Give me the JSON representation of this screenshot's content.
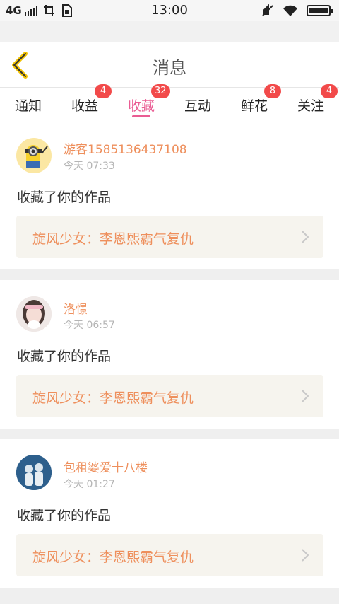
{
  "status_bar": {
    "network": "4G",
    "time": "13:00",
    "icons": [
      "signal-icon",
      "screenshot-icon",
      "sim-card-icon",
      "mute-icon",
      "wifi-icon",
      "battery-icon"
    ]
  },
  "header": {
    "title": "消息",
    "back_icon": "chevron-left-icon",
    "accent": "#f2c200"
  },
  "tabs": [
    {
      "label": "通知",
      "badge": ""
    },
    {
      "label": "收益",
      "badge": "4"
    },
    {
      "label": "收藏",
      "badge": "32",
      "active": true
    },
    {
      "label": "互动",
      "badge": ""
    },
    {
      "label": "鲜花",
      "badge": "8"
    },
    {
      "label": "关注",
      "badge": "4"
    }
  ],
  "colors": {
    "active_tab": "#ea5c93",
    "badge": "#f24a4a",
    "username": "#ee8f5c",
    "work_title": "#ee8f5c",
    "work_bg": "#f6f4ee"
  },
  "messages": [
    {
      "username": "游客1585136437108",
      "time": "今天 07:33",
      "action": "收藏了你的作品",
      "work_title": "旋风少女：李恩熙霸气复仇",
      "avatar": "minion-avatar"
    },
    {
      "username": "洛憬",
      "time": "今天 06:57",
      "action": "收藏了你的作品",
      "work_title": "旋风少女：李恩熙霸气复仇",
      "avatar": "girl-photo-avatar"
    },
    {
      "username": "包租婆爱十八楼",
      "time": "今天 01:27",
      "action": "收藏了你的作品",
      "work_title": "旋风少女：李恩熙霸气复仇",
      "avatar": "couple-photo-avatar"
    }
  ]
}
